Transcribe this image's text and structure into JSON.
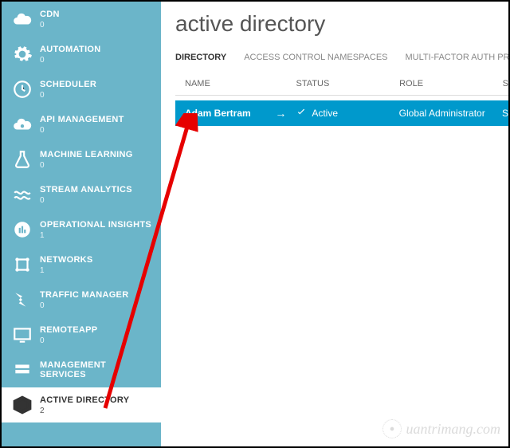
{
  "sidebar": {
    "items": [
      {
        "label": "CDN",
        "count": "0"
      },
      {
        "label": "AUTOMATION",
        "count": "0"
      },
      {
        "label": "SCHEDULER",
        "count": "0"
      },
      {
        "label": "API MANAGEMENT",
        "count": "0"
      },
      {
        "label": "MACHINE LEARNING",
        "count": "0"
      },
      {
        "label": "STREAM ANALYTICS",
        "count": "0"
      },
      {
        "label": "OPERATIONAL INSIGHTS",
        "count": "1"
      },
      {
        "label": "NETWORKS",
        "count": "1"
      },
      {
        "label": "TRAFFIC MANAGER",
        "count": "0"
      },
      {
        "label": "REMOTEAPP",
        "count": "0"
      },
      {
        "label": "MANAGEMENT SERVICES",
        "count": ""
      },
      {
        "label": "ACTIVE DIRECTORY",
        "count": "2",
        "active": true
      }
    ]
  },
  "main": {
    "title": "active directory",
    "tabs": [
      {
        "label": "DIRECTORY",
        "active": true
      },
      {
        "label": "ACCESS CONTROL NAMESPACES"
      },
      {
        "label": "MULTI-FACTOR AUTH PROVIDERS"
      }
    ],
    "columns": {
      "name": "NAME",
      "status": "STATUS",
      "role": "ROLE",
      "sub": "S"
    },
    "rows": [
      {
        "name": "Adam Bertram",
        "status": "Active",
        "role": "Global Administrator",
        "sub": "S"
      }
    ]
  },
  "watermark": "uantrimang.com"
}
